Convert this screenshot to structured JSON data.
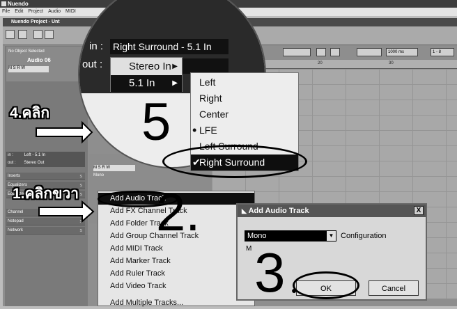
{
  "app_title": "Nuendo",
  "menubar": [
    "File",
    "Edit",
    "Project",
    "Audio",
    "MIDI"
  ],
  "project": {
    "title": "Nuendo Project - Unt",
    "status_text": "No Object Selected",
    "track_name": "Audio 06",
    "routing_in_label": "in :",
    "routing_in_value": "Left - 5.1 In",
    "routing_out_label": "out :",
    "routing_out_value": "Stereo Out",
    "sections": [
      "Inserts",
      "Equalizers",
      "Equalizer Curve",
      "Channel",
      "Notepad",
      "Network"
    ],
    "track_config": "Mono",
    "track_buttons": "M S R W",
    "ruler_marks": [
      "20",
      "30"
    ],
    "zoom_value": "1000 ms",
    "toolbar_tail": "1 - 8"
  },
  "magnifier": {
    "in_label": "in :",
    "in_value": "Right Surround - 5.1 In",
    "out_label": "out :",
    "submenu": [
      {
        "label": "Stereo In"
      },
      {
        "label": "5.1 In"
      }
    ],
    "channels": [
      "Left",
      "Right",
      "Center",
      "LFE",
      "Left Surround",
      "Right Surround"
    ],
    "checked_channel": "Right Surround",
    "checkmark": "✔",
    "lfe_marker": "•"
  },
  "context_menu": {
    "items": [
      "Add Audio Track",
      "Add FX Channel Track",
      "Add Folder Track",
      "Add Group Channel Track",
      "Add MIDI Track",
      "Add Marker Track",
      "Add Ruler Track",
      "Add Video Track",
      "Add Multiple Tracks..."
    ],
    "selected_index": 0
  },
  "dialog": {
    "title": "Add Audio Track",
    "close": "X",
    "config_value": "Mono",
    "config_label": "Configuration",
    "m_label": "M",
    "ok": "OK",
    "cancel": "Cancel"
  },
  "annotations": {
    "step1": "1.คลิกขวา",
    "step2": "2.",
    "step3": "3",
    "step4": "4.คลิก",
    "step5": "5"
  },
  "colors": {
    "highlight": "#0e0e0e",
    "background": "#bdbdbd"
  }
}
